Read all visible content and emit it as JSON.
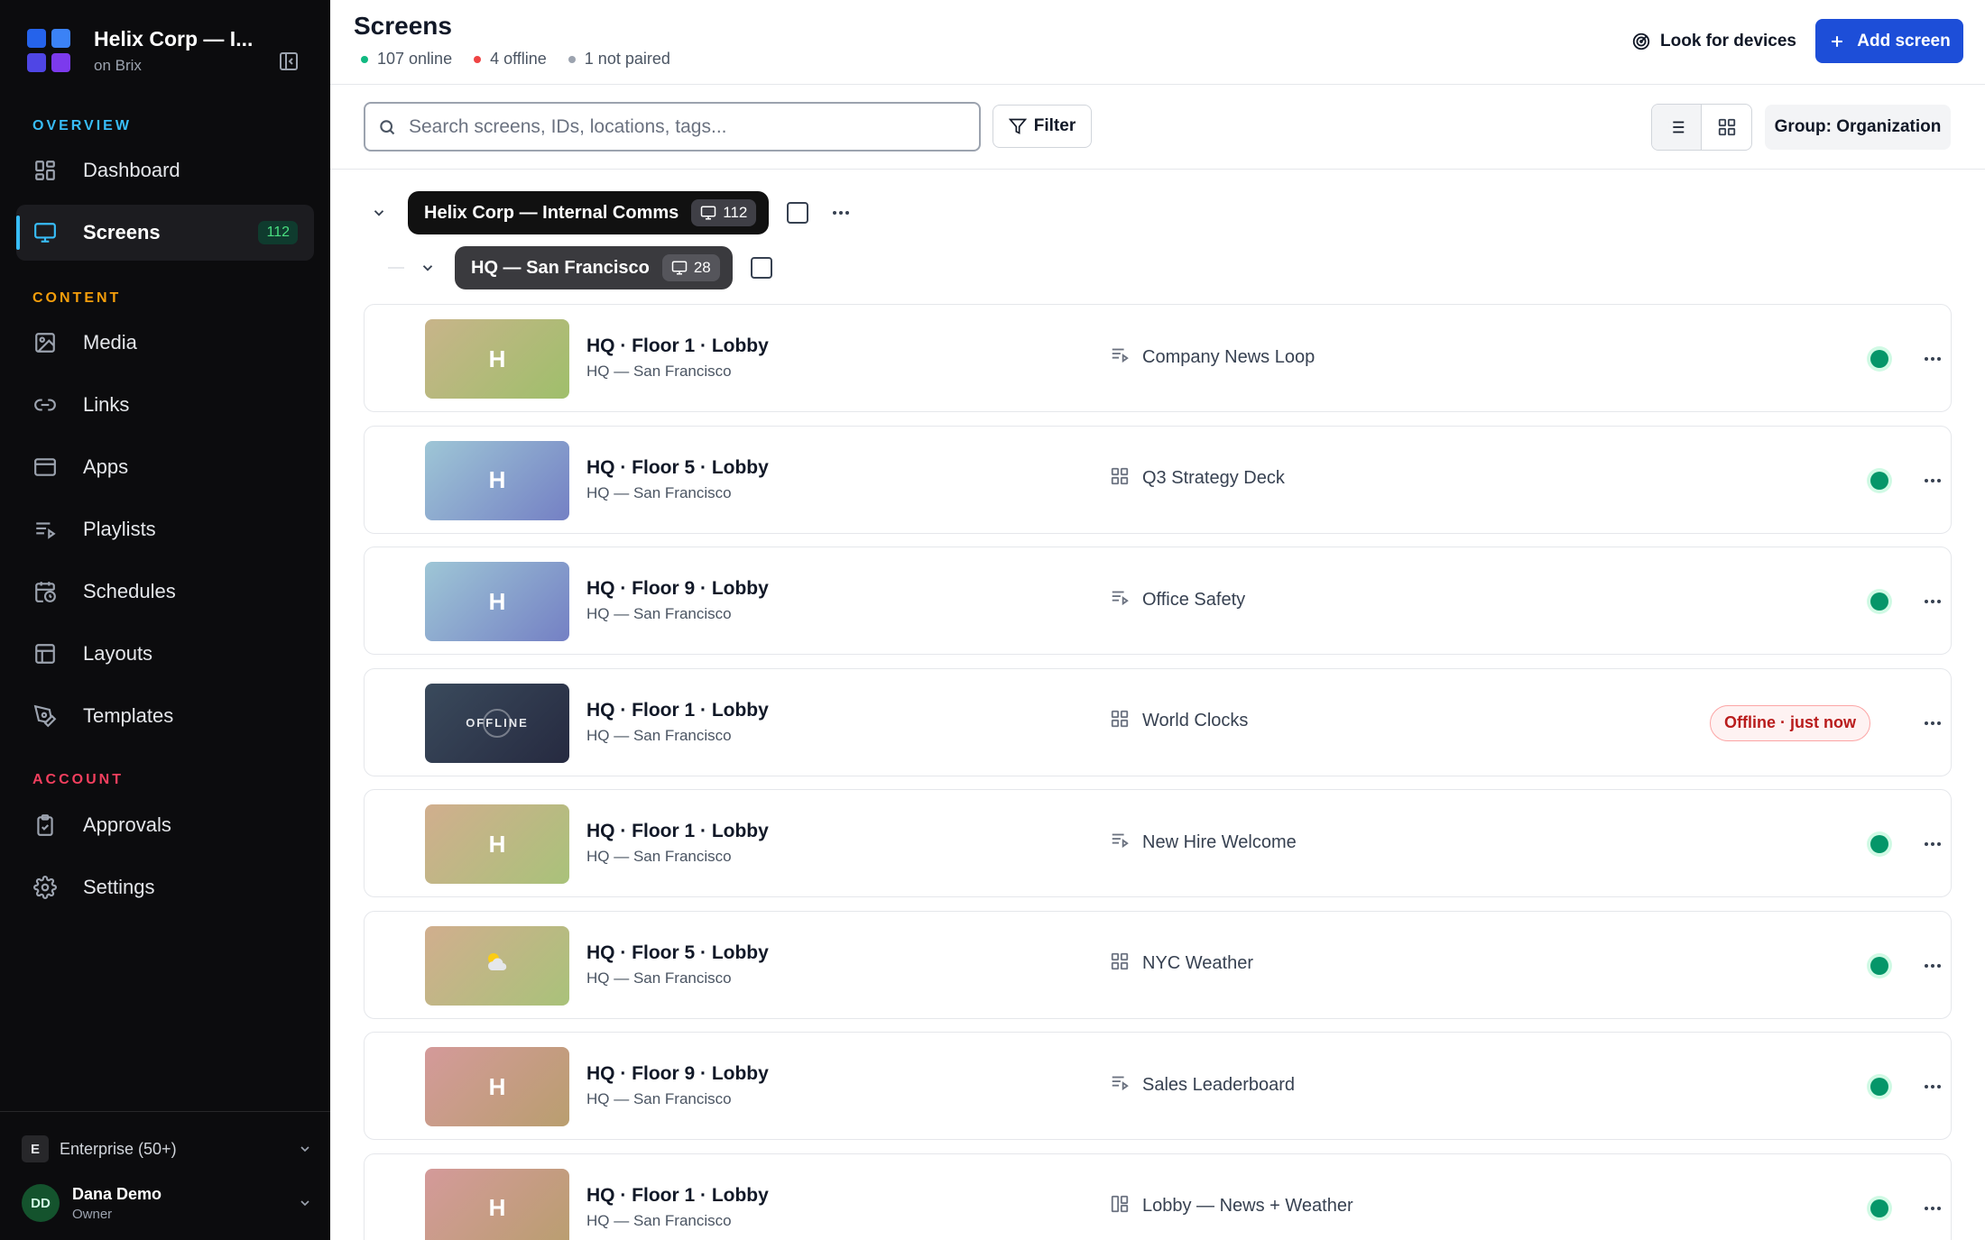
{
  "sidebar": {
    "org_name": "Helix Corp — I...",
    "org_sub": "on Brix",
    "logo_colors": [
      "#2563eb",
      "#3b82f6",
      "#4f46e5",
      "#7c3aed"
    ],
    "sections": {
      "overview": "OVERVIEW",
      "content": "CONTENT",
      "account": "ACCOUNT"
    },
    "section_colors": {
      "overview": "#38bdf8",
      "content": "#f59e0b",
      "account": "#f43f5e"
    },
    "items": [
      {
        "label": "Dashboard",
        "icon": "dashboard-icon"
      },
      {
        "label": "Screens",
        "icon": "monitor-icon",
        "badge": "112",
        "active": true
      },
      {
        "label": "Media",
        "icon": "image-icon"
      },
      {
        "label": "Links",
        "icon": "link-icon"
      },
      {
        "label": "Apps",
        "icon": "app-window-icon"
      },
      {
        "label": "Playlists",
        "icon": "playlist-icon"
      },
      {
        "label": "Schedules",
        "icon": "calendar-clock-icon"
      },
      {
        "label": "Layouts",
        "icon": "layout-icon"
      },
      {
        "label": "Templates",
        "icon": "template-icon"
      },
      {
        "label": "Approvals",
        "icon": "clipboard-check-icon"
      },
      {
        "label": "Settings",
        "icon": "gear-icon"
      }
    ],
    "plan": {
      "letter": "E",
      "label": "Enterprise (50+)"
    },
    "user": {
      "initials": "DD",
      "name": "Dana Demo",
      "role": "Owner"
    }
  },
  "header": {
    "title": "Screens",
    "stats": {
      "online": "107 online",
      "offline": "4 offline",
      "not_paired": "1 not paired"
    },
    "stat_colors": {
      "online": "#10b981",
      "offline": "#ef4444",
      "not_paired": "#9ca3af"
    },
    "look_label": "Look for devices",
    "add_label": "Add screen",
    "accent": "#1d4ed8"
  },
  "toolbar": {
    "search_placeholder": "Search screens, IDs, locations, tags...",
    "filter_label": "Filter",
    "group_label": "Group: Organization"
  },
  "groups": {
    "org": {
      "label": "Helix Corp — Internal Comms",
      "count": "112"
    },
    "site": {
      "label": "HQ — San Francisco",
      "count": "28"
    }
  },
  "screens": [
    {
      "name": "HQ · Floor 1 · Lobby",
      "location": "HQ — San Francisco",
      "content": "Company News Loop",
      "content_icon": "playlist-icon",
      "thumb": "H",
      "gradient": [
        "#c8b48a",
        "#9fbf6b"
      ],
      "status": "online"
    },
    {
      "name": "HQ · Floor 5 · Lobby",
      "location": "HQ — San Francisco",
      "content": "Q3 Strategy Deck",
      "content_icon": "app-grid-icon",
      "thumb": "H",
      "gradient": [
        "#9ec6d6",
        "#7480c4"
      ],
      "status": "online"
    },
    {
      "name": "HQ · Floor 9 · Lobby",
      "location": "HQ — San Francisco",
      "content": "Office Safety",
      "content_icon": "playlist-icon",
      "thumb": "H",
      "gradient": [
        "#9ec6d6",
        "#7480c4"
      ],
      "status": "online"
    },
    {
      "name": "HQ · Floor 1 · Lobby",
      "location": "HQ — San Francisco",
      "content": "World Clocks",
      "content_icon": "app-grid-icon",
      "thumb": "OFFLINE",
      "gradient": [
        "#3a4a5c",
        "#262a40"
      ],
      "status": "offline",
      "status_label": "Offline · just now"
    },
    {
      "name": "HQ · Floor 1 · Lobby",
      "location": "HQ — San Francisco",
      "content": "New Hire Welcome",
      "content_icon": "playlist-icon",
      "thumb": "H",
      "gradient": [
        "#d1ae8e",
        "#a9c27a"
      ],
      "status": "online"
    },
    {
      "name": "HQ · Floor 5 · Lobby",
      "location": "HQ — San Francisco",
      "content": "NYC Weather",
      "content_icon": "app-grid-icon",
      "thumb": "weather-icon",
      "gradient": [
        "#d1ae8e",
        "#a9c27a"
      ],
      "status": "online"
    },
    {
      "name": "HQ · Floor 9 · Lobby",
      "location": "HQ — San Francisco",
      "content": "Sales Leaderboard",
      "content_icon": "playlist-icon",
      "thumb": "H",
      "gradient": [
        "#d49a9a",
        "#b99e6f"
      ],
      "status": "online"
    },
    {
      "name": "HQ · Floor 1 · Lobby",
      "location": "HQ — San Francisco",
      "content": "Lobby — News + Weather",
      "content_icon": "layout-icon",
      "thumb": "H",
      "gradient": [
        "#d49a9a",
        "#b99e6f"
      ],
      "status": "online"
    }
  ]
}
